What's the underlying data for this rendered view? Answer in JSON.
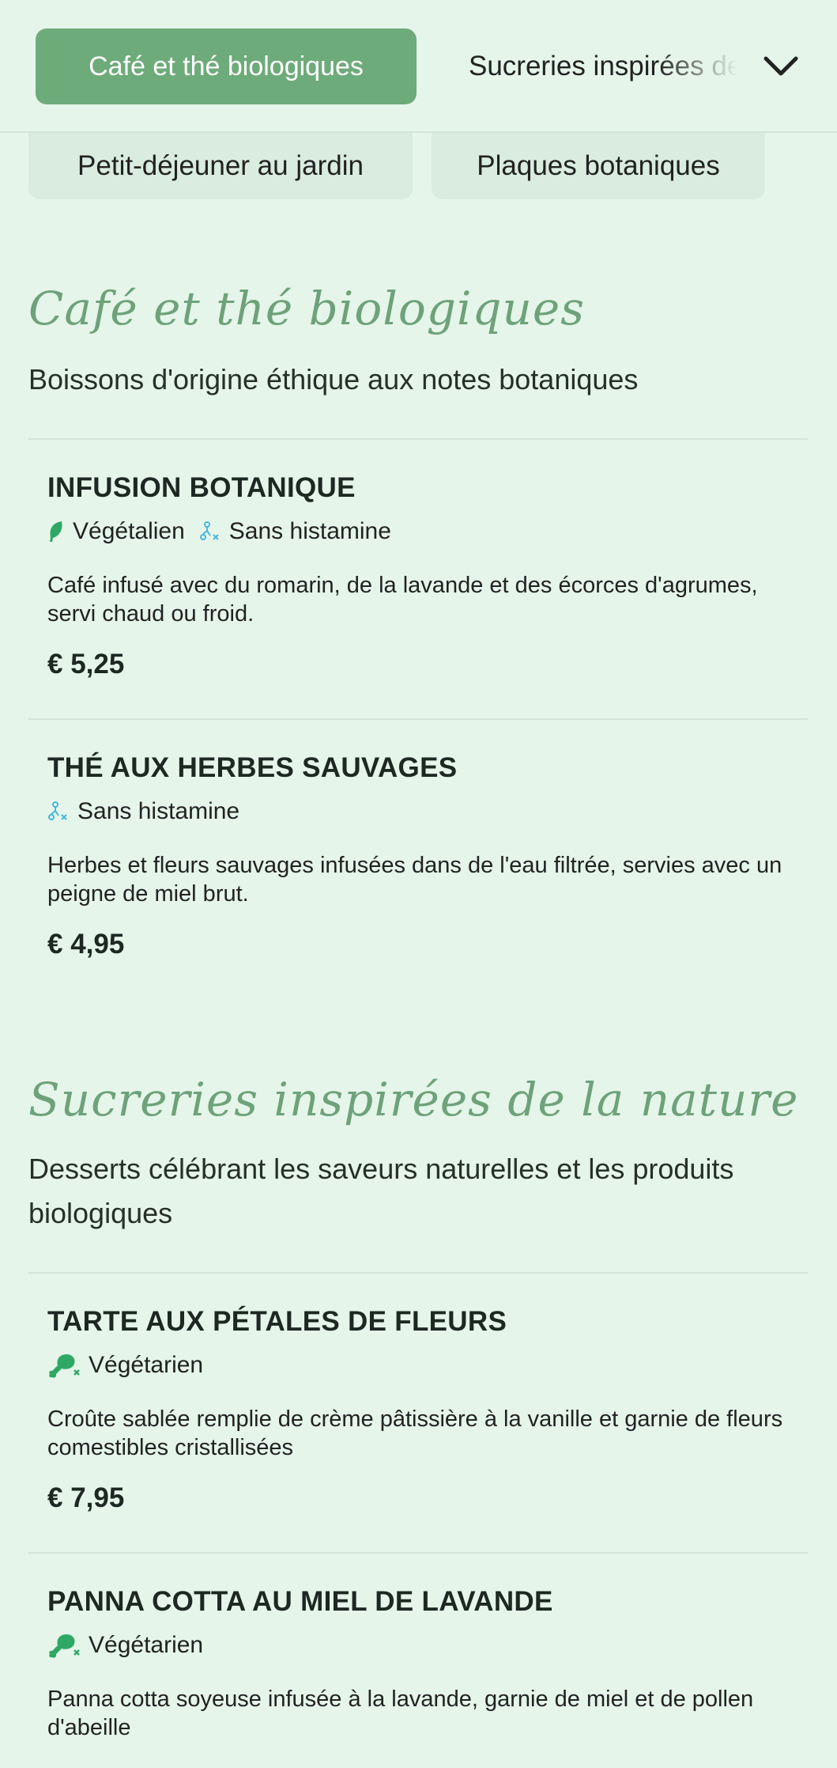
{
  "categories": {
    "active": "Café et thé biologiques",
    "next": "Sucreries inspirées de la nature",
    "row2": [
      "Petit-déjeuner au jardin",
      "Plaques botaniques"
    ]
  },
  "icons": {
    "toggle": "chevron-down-icon",
    "vegan": "leaf-icon",
    "histamine": "histamine-free-icon",
    "vegetarian": "drumstick-crossed-icon"
  },
  "colors": {
    "background": "#e5f5ea",
    "accent": "#6eab7a",
    "title": "#6ea27a",
    "vegan": "#2fa866",
    "histamine": "#46b8d9"
  },
  "sections": [
    {
      "title": "Café et thé biologiques",
      "description": "Boissons d'origine éthique aux notes botaniques",
      "items": [
        {
          "name": "INFUSION BOTANIQUE",
          "badges": [
            "Végétalien",
            "Sans histamine"
          ],
          "description": "Café infusé avec du romarin, de la lavande et des écorces d'agrumes, servi chaud ou froid.",
          "price": "€ 5,25"
        },
        {
          "name": "THÉ AUX HERBES SAUVAGES",
          "badges": [
            "Sans histamine"
          ],
          "description": "Herbes et fleurs sauvages infusées dans de l'eau filtrée, servies avec un peigne de miel brut.",
          "price": "€ 4,95"
        }
      ]
    },
    {
      "title": "Sucreries inspirées de la nature",
      "description": "Desserts célébrant les saveurs naturelles et les produits biologiques",
      "items": [
        {
          "name": "TARTE AUX PÉTALES DE FLEURS",
          "badges": [
            "Végétarien"
          ],
          "description": "Croûte sablée remplie de crème pâtissière à la vanille et garnie de fleurs comestibles cristallisées",
          "price": "€ 7,95"
        },
        {
          "name": "PANNA COTTA AU MIEL DE LAVANDE",
          "badges": [
            "Végétarien"
          ],
          "description": "Panna cotta soyeuse infusée à la lavande, garnie de miel et de pollen d'abeille"
        }
      ]
    }
  ]
}
